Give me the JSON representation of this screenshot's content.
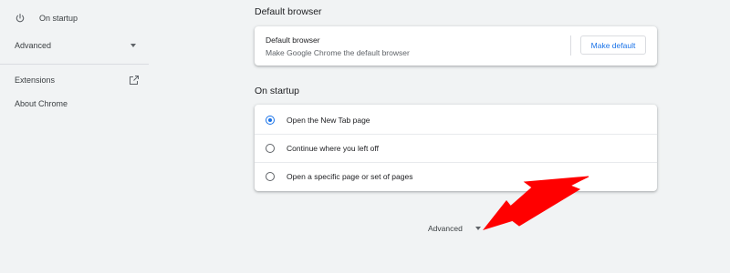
{
  "sidebar": {
    "items": [
      {
        "label": "On startup",
        "icon": "power-icon"
      },
      {
        "label": "Advanced",
        "icon": "chevron-down-icon"
      },
      {
        "label": "Extensions",
        "icon": "open-in-new-icon"
      },
      {
        "label": "About Chrome"
      }
    ]
  },
  "main": {
    "default_browser": {
      "section_title": "Default browser",
      "card_title": "Default browser",
      "card_subtitle": "Make Google Chrome the default browser",
      "button_label": "Make default"
    },
    "on_startup": {
      "section_title": "On startup",
      "options": [
        {
          "label": "Open the New Tab page",
          "selected": true
        },
        {
          "label": "Continue where you left off",
          "selected": false
        },
        {
          "label": "Open a specific page or set of pages",
          "selected": false
        }
      ]
    },
    "advanced_toggle": {
      "label": "Advanced"
    }
  },
  "colors": {
    "accent": "#1a73e8",
    "annotation_arrow": "#ff0000",
    "background": "#f1f3f4"
  },
  "annotation": {
    "icon": "red-arrow-icon"
  }
}
